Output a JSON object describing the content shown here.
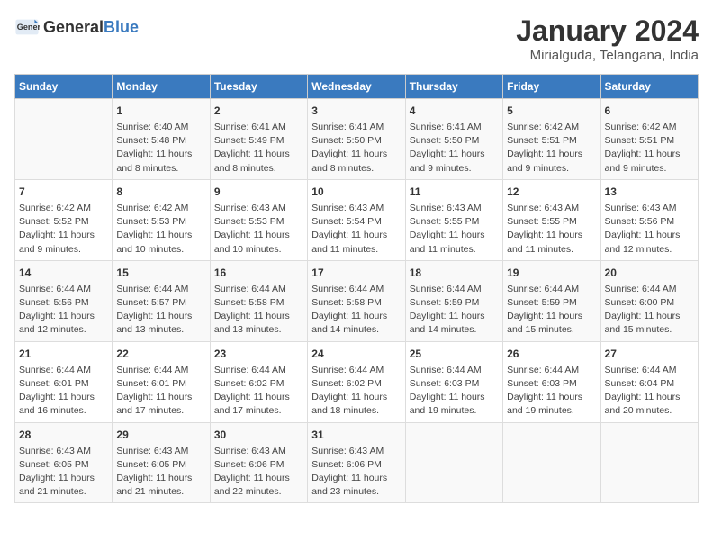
{
  "header": {
    "logo_general": "General",
    "logo_blue": "Blue",
    "main_title": "January 2024",
    "subtitle": "Mirialguda, Telangana, India"
  },
  "columns": [
    "Sunday",
    "Monday",
    "Tuesday",
    "Wednesday",
    "Thursday",
    "Friday",
    "Saturday"
  ],
  "weeks": [
    [
      {
        "day": "",
        "content": ""
      },
      {
        "day": "1",
        "content": "Sunrise: 6:40 AM\nSunset: 5:48 PM\nDaylight: 11 hours\nand 8 minutes."
      },
      {
        "day": "2",
        "content": "Sunrise: 6:41 AM\nSunset: 5:49 PM\nDaylight: 11 hours\nand 8 minutes."
      },
      {
        "day": "3",
        "content": "Sunrise: 6:41 AM\nSunset: 5:50 PM\nDaylight: 11 hours\nand 8 minutes."
      },
      {
        "day": "4",
        "content": "Sunrise: 6:41 AM\nSunset: 5:50 PM\nDaylight: 11 hours\nand 9 minutes."
      },
      {
        "day": "5",
        "content": "Sunrise: 6:42 AM\nSunset: 5:51 PM\nDaylight: 11 hours\nand 9 minutes."
      },
      {
        "day": "6",
        "content": "Sunrise: 6:42 AM\nSunset: 5:51 PM\nDaylight: 11 hours\nand 9 minutes."
      }
    ],
    [
      {
        "day": "7",
        "content": "Sunrise: 6:42 AM\nSunset: 5:52 PM\nDaylight: 11 hours\nand 9 minutes."
      },
      {
        "day": "8",
        "content": "Sunrise: 6:42 AM\nSunset: 5:53 PM\nDaylight: 11 hours\nand 10 minutes."
      },
      {
        "day": "9",
        "content": "Sunrise: 6:43 AM\nSunset: 5:53 PM\nDaylight: 11 hours\nand 10 minutes."
      },
      {
        "day": "10",
        "content": "Sunrise: 6:43 AM\nSunset: 5:54 PM\nDaylight: 11 hours\nand 11 minutes."
      },
      {
        "day": "11",
        "content": "Sunrise: 6:43 AM\nSunset: 5:55 PM\nDaylight: 11 hours\nand 11 minutes."
      },
      {
        "day": "12",
        "content": "Sunrise: 6:43 AM\nSunset: 5:55 PM\nDaylight: 11 hours\nand 11 minutes."
      },
      {
        "day": "13",
        "content": "Sunrise: 6:43 AM\nSunset: 5:56 PM\nDaylight: 11 hours\nand 12 minutes."
      }
    ],
    [
      {
        "day": "14",
        "content": "Sunrise: 6:44 AM\nSunset: 5:56 PM\nDaylight: 11 hours\nand 12 minutes."
      },
      {
        "day": "15",
        "content": "Sunrise: 6:44 AM\nSunset: 5:57 PM\nDaylight: 11 hours\nand 13 minutes."
      },
      {
        "day": "16",
        "content": "Sunrise: 6:44 AM\nSunset: 5:58 PM\nDaylight: 11 hours\nand 13 minutes."
      },
      {
        "day": "17",
        "content": "Sunrise: 6:44 AM\nSunset: 5:58 PM\nDaylight: 11 hours\nand 14 minutes."
      },
      {
        "day": "18",
        "content": "Sunrise: 6:44 AM\nSunset: 5:59 PM\nDaylight: 11 hours\nand 14 minutes."
      },
      {
        "day": "19",
        "content": "Sunrise: 6:44 AM\nSunset: 5:59 PM\nDaylight: 11 hours\nand 15 minutes."
      },
      {
        "day": "20",
        "content": "Sunrise: 6:44 AM\nSunset: 6:00 PM\nDaylight: 11 hours\nand 15 minutes."
      }
    ],
    [
      {
        "day": "21",
        "content": "Sunrise: 6:44 AM\nSunset: 6:01 PM\nDaylight: 11 hours\nand 16 minutes."
      },
      {
        "day": "22",
        "content": "Sunrise: 6:44 AM\nSunset: 6:01 PM\nDaylight: 11 hours\nand 17 minutes."
      },
      {
        "day": "23",
        "content": "Sunrise: 6:44 AM\nSunset: 6:02 PM\nDaylight: 11 hours\nand 17 minutes."
      },
      {
        "day": "24",
        "content": "Sunrise: 6:44 AM\nSunset: 6:02 PM\nDaylight: 11 hours\nand 18 minutes."
      },
      {
        "day": "25",
        "content": "Sunrise: 6:44 AM\nSunset: 6:03 PM\nDaylight: 11 hours\nand 19 minutes."
      },
      {
        "day": "26",
        "content": "Sunrise: 6:44 AM\nSunset: 6:03 PM\nDaylight: 11 hours\nand 19 minutes."
      },
      {
        "day": "27",
        "content": "Sunrise: 6:44 AM\nSunset: 6:04 PM\nDaylight: 11 hours\nand 20 minutes."
      }
    ],
    [
      {
        "day": "28",
        "content": "Sunrise: 6:43 AM\nSunset: 6:05 PM\nDaylight: 11 hours\nand 21 minutes."
      },
      {
        "day": "29",
        "content": "Sunrise: 6:43 AM\nSunset: 6:05 PM\nDaylight: 11 hours\nand 21 minutes."
      },
      {
        "day": "30",
        "content": "Sunrise: 6:43 AM\nSunset: 6:06 PM\nDaylight: 11 hours\nand 22 minutes."
      },
      {
        "day": "31",
        "content": "Sunrise: 6:43 AM\nSunset: 6:06 PM\nDaylight: 11 hours\nand 23 minutes."
      },
      {
        "day": "",
        "content": ""
      },
      {
        "day": "",
        "content": ""
      },
      {
        "day": "",
        "content": ""
      }
    ]
  ]
}
